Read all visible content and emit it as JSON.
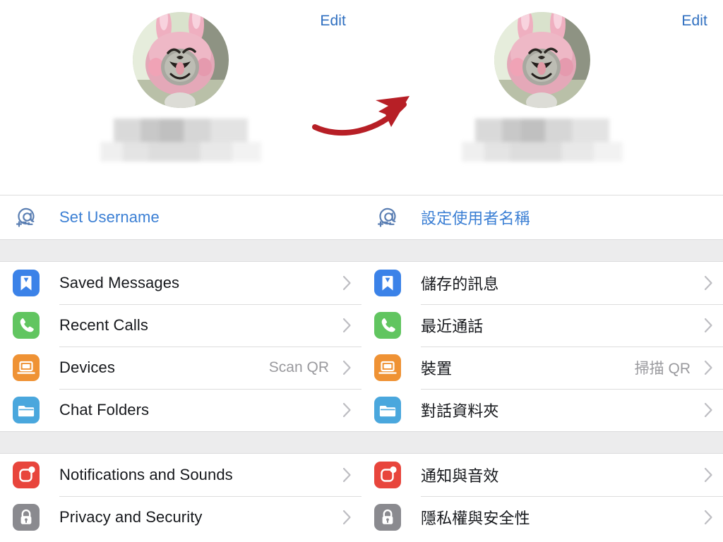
{
  "panels": [
    {
      "id": "english",
      "header": {
        "edit_label": "Edit",
        "avatar_name": "profile-avatar",
        "name_hidden": true
      },
      "username_row": {
        "icon": "at-plus-icon",
        "label": "Set Username"
      },
      "sections": [
        {
          "rows": [
            {
              "icon": "bookmark-icon",
              "icon_color": "#3b82e8",
              "label": "Saved Messages",
              "value": "",
              "chevron": true
            },
            {
              "icon": "phone-icon",
              "icon_color": "#61c560",
              "label": "Recent Calls",
              "value": "",
              "chevron": true
            },
            {
              "icon": "laptop-icon",
              "icon_color": "#ef9234",
              "label": "Devices",
              "value": "Scan QR",
              "chevron": true
            },
            {
              "icon": "folder-icon",
              "icon_color": "#4aa7dd",
              "label": "Chat Folders",
              "value": "",
              "chevron": true
            }
          ]
        },
        {
          "rows": [
            {
              "icon": "notification-bell-icon",
              "icon_color": "#e8453c",
              "label": "Notifications and Sounds",
              "value": "",
              "chevron": true
            },
            {
              "icon": "lock-icon",
              "icon_color": "#8a8a8f",
              "label": "Privacy and Security",
              "value": "",
              "chevron": true
            }
          ]
        }
      ]
    },
    {
      "id": "traditional-chinese",
      "header": {
        "edit_label": "Edit",
        "avatar_name": "profile-avatar",
        "name_hidden": true
      },
      "username_row": {
        "icon": "at-plus-icon",
        "label": "設定使用者名稱"
      },
      "sections": [
        {
          "rows": [
            {
              "icon": "bookmark-icon",
              "icon_color": "#3b82e8",
              "label": "儲存的訊息",
              "value": "",
              "chevron": true
            },
            {
              "icon": "phone-icon",
              "icon_color": "#61c560",
              "label": "最近通話",
              "value": "",
              "chevron": true
            },
            {
              "icon": "laptop-icon",
              "icon_color": "#ef9234",
              "label": "裝置",
              "value": "掃描 QR",
              "chevron": true
            },
            {
              "icon": "folder-icon",
              "icon_color": "#4aa7dd",
              "label": "對話資料夾",
              "value": "",
              "chevron": true
            }
          ]
        },
        {
          "rows": [
            {
              "icon": "notification-bell-icon",
              "icon_color": "#e8453c",
              "label": "通知與音效",
              "value": "",
              "chevron": true
            },
            {
              "icon": "lock-icon",
              "icon_color": "#8a8a8f",
              "label": "隱私權與安全性",
              "value": "",
              "chevron": true
            }
          ]
        }
      ]
    }
  ],
  "annotation": {
    "arrow": "curved-red-arrow",
    "arrow_color": "#b71f26"
  },
  "colors": {
    "link_blue": "#3b7fd4",
    "edit_blue": "#2f6fc0",
    "text_primary": "#16181c",
    "text_secondary": "#9a9a9e",
    "separator": "#dddddd",
    "section_gap": "#ececed",
    "background": "#ffffff"
  }
}
